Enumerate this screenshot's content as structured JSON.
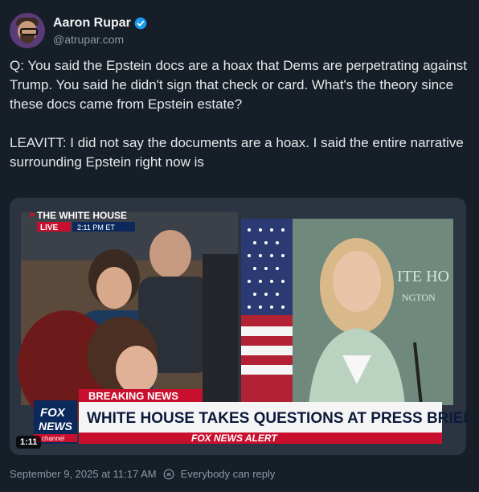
{
  "author": {
    "display_name": "Aaron Rupar",
    "handle": "@atrupar.com"
  },
  "post": {
    "text": "Q: You said the Epstein docs are a hoax that Dems are perpetrating against Trump. You said he didn't sign that check or card. What's the theory since these docs came from Epstein estate?\n\nLEAVITT: I did not say the documents are a hoax. I said the entire narrative surrounding Epstein right now is"
  },
  "video": {
    "location_label": "THE WHITE HOUSE",
    "live_label": "LIVE",
    "time_label": "2:11 PM ET",
    "backdrop_text_1": "ITE HO",
    "backdrop_text_2": "NGTON",
    "breaking_label": "BREAKING NEWS",
    "headline": "WHITE HOUSE TAKES QUESTIONS AT PRESS BRIEFING",
    "network_logo_1": "FOX",
    "network_logo_2": "NEWS",
    "network_logo_3": "channel",
    "alert_label": "FOX NEWS ALERT",
    "duration": "1:11"
  },
  "footer": {
    "timestamp": "September 9, 2025 at 11:17 AM",
    "reply_setting": "Everybody can reply"
  },
  "colors": {
    "background": "#161e27",
    "accent_blue": "#1d9bf0",
    "fox_red": "#c8102e",
    "fox_navy": "#0b2a5b"
  }
}
